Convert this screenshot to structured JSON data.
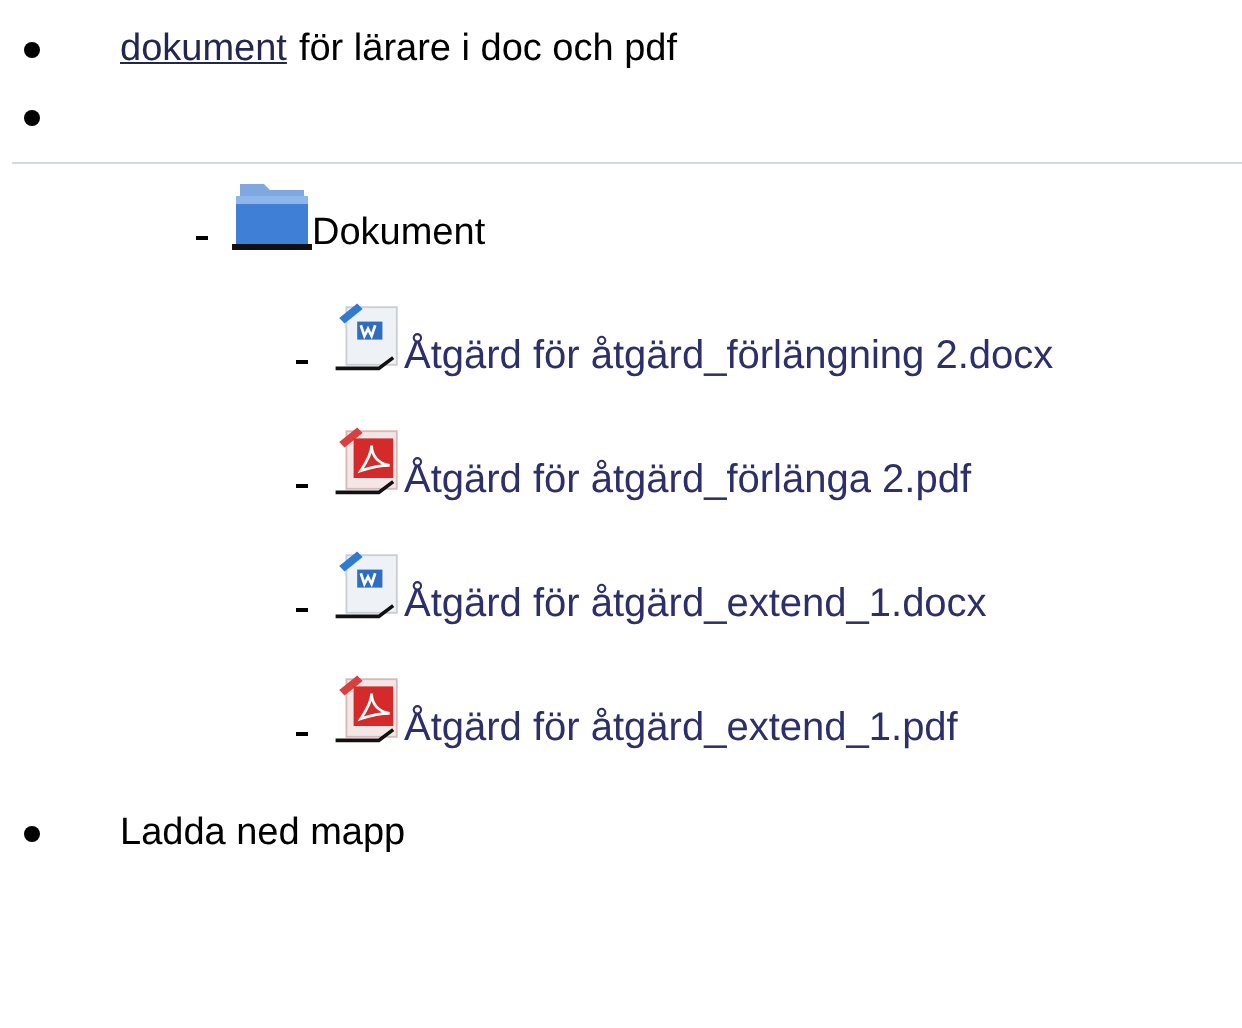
{
  "top_list": [
    {
      "kind": "text",
      "link": "dokument",
      "text": "för lärare i doc och pdf"
    },
    {
      "kind": "blank"
    }
  ],
  "folder": {
    "name": "Dokument",
    "files": [
      {
        "kind": "word",
        "name": "Åtgärd för åtgärd_förlängning 2.docx"
      },
      {
        "kind": "pdf",
        "name": "Åtgärd för åtgärd_förlänga 2.pdf"
      },
      {
        "kind": "word",
        "name": "Åtgärd för åtgärd_extend_1.docx"
      },
      {
        "kind": "pdf",
        "name": "Åtgärd för åtgärd_extend_1.pdf"
      }
    ]
  },
  "bottom_list": [
    "Ladda ned mapp"
  ]
}
